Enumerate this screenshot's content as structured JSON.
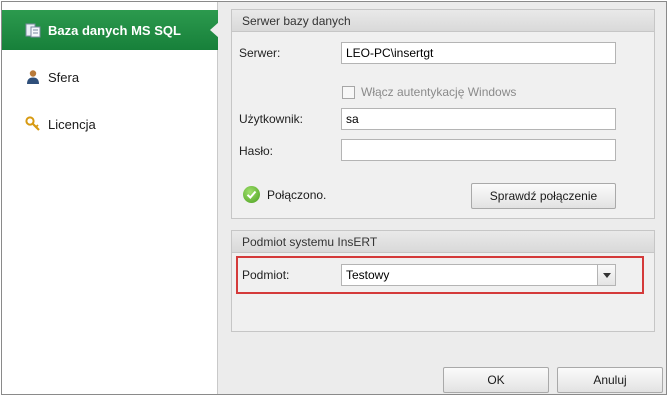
{
  "sidebar": {
    "items": [
      {
        "label": "Baza danych MS SQL",
        "icon": "database-icon",
        "active": true
      },
      {
        "label": "Sfera",
        "icon": "user-icon",
        "active": false
      },
      {
        "label": "Licencja",
        "icon": "key-icon",
        "active": false
      }
    ]
  },
  "server_group": {
    "title": "Serwer bazy danych",
    "server_label": "Serwer:",
    "server_value": "LEO-PC\\insertgt",
    "windows_auth_label": "Włącz autentykację Windows",
    "user_label": "Użytkownik:",
    "user_value": "sa",
    "password_label": "Hasło:",
    "password_value": "",
    "status_text": "Połączono.",
    "test_button": "Sprawdź połączenie"
  },
  "entity_group": {
    "title": "Podmiot systemu InsERT",
    "entity_label": "Podmiot:",
    "entity_value": "Testowy"
  },
  "footer": {
    "ok_label": "OK",
    "cancel_label": "Anuluj"
  },
  "colors": {
    "accent": "#17803a",
    "highlight": "#d43a3a"
  }
}
